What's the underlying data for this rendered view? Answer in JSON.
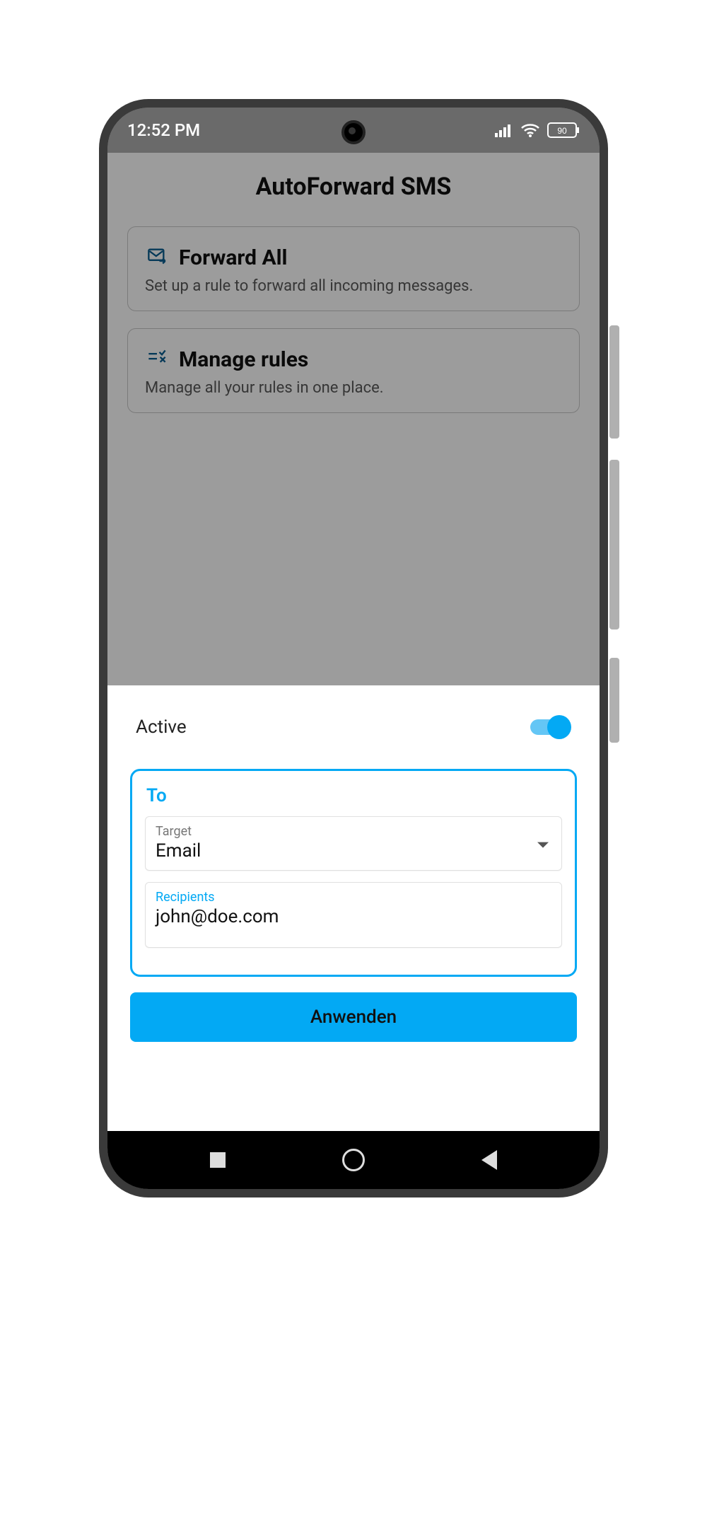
{
  "status": {
    "time": "12:52 PM",
    "battery": "90"
  },
  "header": {
    "title": "AutoForward SMS"
  },
  "cards": [
    {
      "icon": "mail-forward-icon",
      "title": "Forward All",
      "subtitle": "Set up a rule to forward all incoming messages."
    },
    {
      "icon": "rules-icon",
      "title": "Manage rules",
      "subtitle": "Manage all your rules in one place."
    }
  ],
  "sheet": {
    "active_label": "Active",
    "active_on": true,
    "to_label": "To",
    "target_label": "Target",
    "target_value": "Email",
    "recipients_label": "Recipients",
    "recipients_value": "john@doe.com",
    "apply_label": "Anwenden"
  }
}
